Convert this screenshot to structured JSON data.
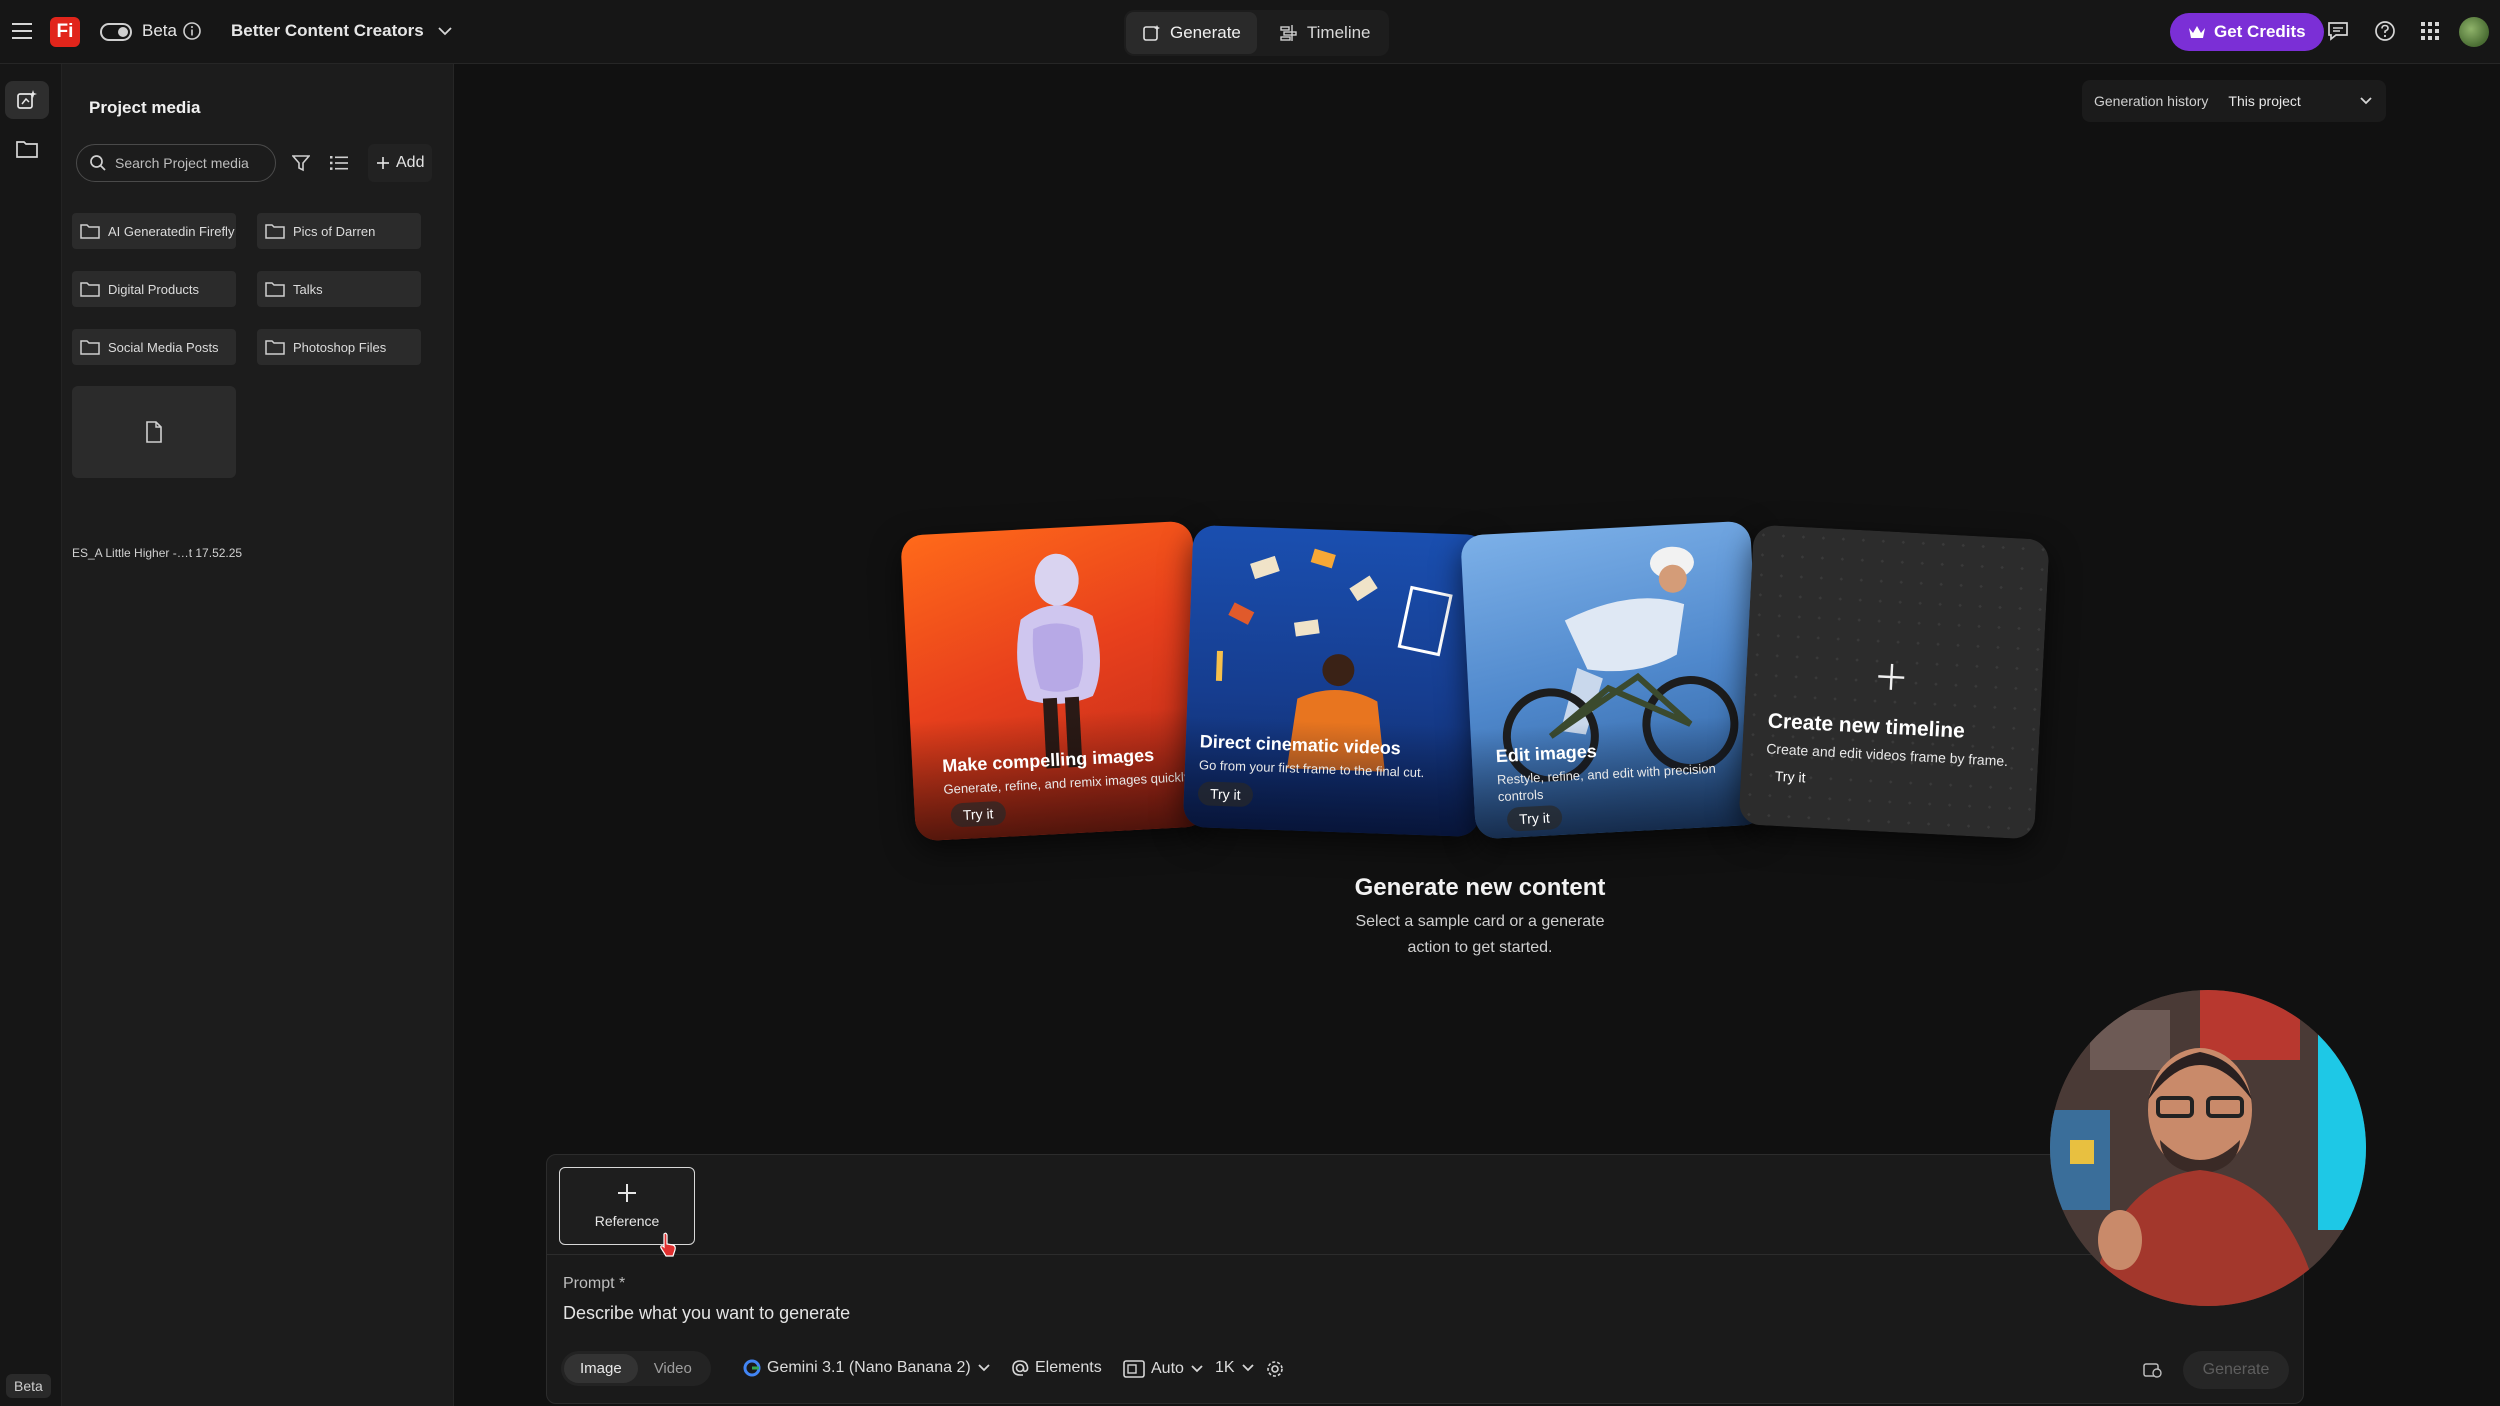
{
  "topbar": {
    "menu_icon": "hamburger-icon",
    "logo": "Fi",
    "beta_label": "Beta",
    "project_name": "Better Content Creators",
    "tabs": [
      {
        "label": "Generate",
        "active": true,
        "icon": "generate-icon"
      },
      {
        "label": "Timeline",
        "active": false,
        "icon": "timeline-icon"
      }
    ],
    "credits_label": "Get Credits",
    "accent": "#7b2fd6"
  },
  "rail": {
    "beta_badge": "Beta"
  },
  "panel": {
    "title": "Project media",
    "search_placeholder": "Search Project media",
    "add_label": "Add",
    "folders": [
      "AI Generatedin Firefly",
      "Pics of Darren",
      "Digital Products",
      "Talks",
      "Social Media Posts",
      "Photoshop Files"
    ],
    "file": {
      "name": "ES_A Little Higher -…t 17.52.25"
    }
  },
  "history": {
    "label": "Generation history",
    "value": "This project"
  },
  "cards": [
    {
      "title": "Make compelling images",
      "subtitle": "Generate, refine, and remix images quickly.",
      "cta": "Try it"
    },
    {
      "title": "Direct cinematic videos",
      "subtitle": "Go from your first frame to the final cut.",
      "cta": "Try it"
    },
    {
      "title": "Edit images",
      "subtitle": "Restyle, refine, and edit with precision controls",
      "cta": "Try it"
    },
    {
      "title": "Create new timeline",
      "subtitle": "Create and edit videos frame by frame.",
      "cta": "Try it"
    }
  ],
  "empty_state": {
    "title": "Generate new content",
    "line1": "Select a sample card or a generate",
    "line2": "action to get started."
  },
  "prompt": {
    "reference_label": "Reference",
    "label": "Prompt *",
    "placeholder": "Describe what you want to generate",
    "modes": [
      {
        "label": "Image",
        "active": true
      },
      {
        "label": "Video",
        "active": false
      }
    ],
    "model": "Gemini 3.1 (Nano Banana 2)",
    "elements_label": "Elements",
    "aspect": "Auto",
    "resolution": "1K",
    "generate_label": "Generate"
  }
}
